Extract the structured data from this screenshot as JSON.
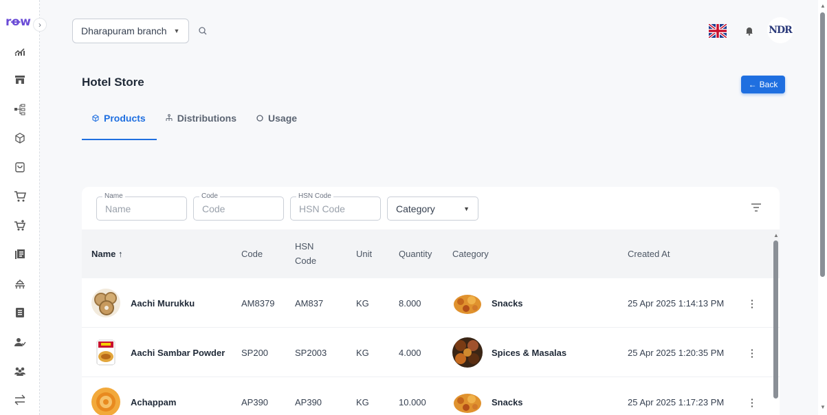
{
  "app": {
    "logo": "rꝋw",
    "collapse_icon": "chevron-right-icon"
  },
  "sidebar": {
    "items": [
      {
        "icon": "analytics-icon"
      },
      {
        "icon": "store-icon"
      },
      {
        "icon": "hierarchy-icon"
      },
      {
        "icon": "cube-icon"
      },
      {
        "icon": "bag-icon"
      },
      {
        "icon": "cart-icon"
      },
      {
        "icon": "cart-add-icon"
      },
      {
        "icon": "library-icon"
      },
      {
        "icon": "dining-icon"
      },
      {
        "icon": "book-icon"
      },
      {
        "icon": "user-check-icon"
      },
      {
        "icon": "group-icon"
      },
      {
        "icon": "transfer-icon"
      }
    ]
  },
  "header": {
    "branch": "Dharapuram branch",
    "language_flag": "uk-flag-icon",
    "avatar_text": "NDR"
  },
  "page": {
    "title": "Hotel Store",
    "back_label": "Back",
    "tabs": [
      {
        "label": "Products",
        "icon": "cube-icon",
        "active": true
      },
      {
        "label": "Distributions",
        "icon": "hierarchy-icon",
        "active": false
      },
      {
        "label": "Usage",
        "icon": "circle-icon",
        "active": false
      }
    ]
  },
  "filters": {
    "name": {
      "legend": "Name",
      "placeholder": "Name"
    },
    "code": {
      "legend": "Code",
      "placeholder": "Code"
    },
    "hsn": {
      "legend": "HSN Code",
      "placeholder": "HSN Code"
    },
    "category": {
      "placeholder": "Category"
    }
  },
  "table": {
    "headers": {
      "name": "Name ↑",
      "code": "Code",
      "hsn_line1": "HSN",
      "hsn_line2": "Code",
      "unit": "Unit",
      "quantity": "Quantity",
      "category": "Category",
      "created_at": "Created At"
    },
    "rows": [
      {
        "name": "Aachi Murukku",
        "code": "AM8379",
        "hsn": "AM837",
        "unit": "KG",
        "quantity": "8.000",
        "category": "Snacks",
        "created_at": "25 Apr 2025 1:14:13 PM"
      },
      {
        "name": "Aachi Sambar Powder",
        "code": "SP200",
        "hsn": "SP2003",
        "unit": "KG",
        "quantity": "4.000",
        "category": "Spices & Masalas",
        "created_at": "25 Apr 2025 1:20:35 PM"
      },
      {
        "name": "Achappam",
        "code": "AP390",
        "hsn": "AP390",
        "unit": "KG",
        "quantity": "10.000",
        "category": "Snacks",
        "created_at": "25 Apr 2025 1:17:23 PM"
      }
    ]
  },
  "colors": {
    "accent": "#1f6fe0",
    "logo": "#6a4bd6"
  }
}
